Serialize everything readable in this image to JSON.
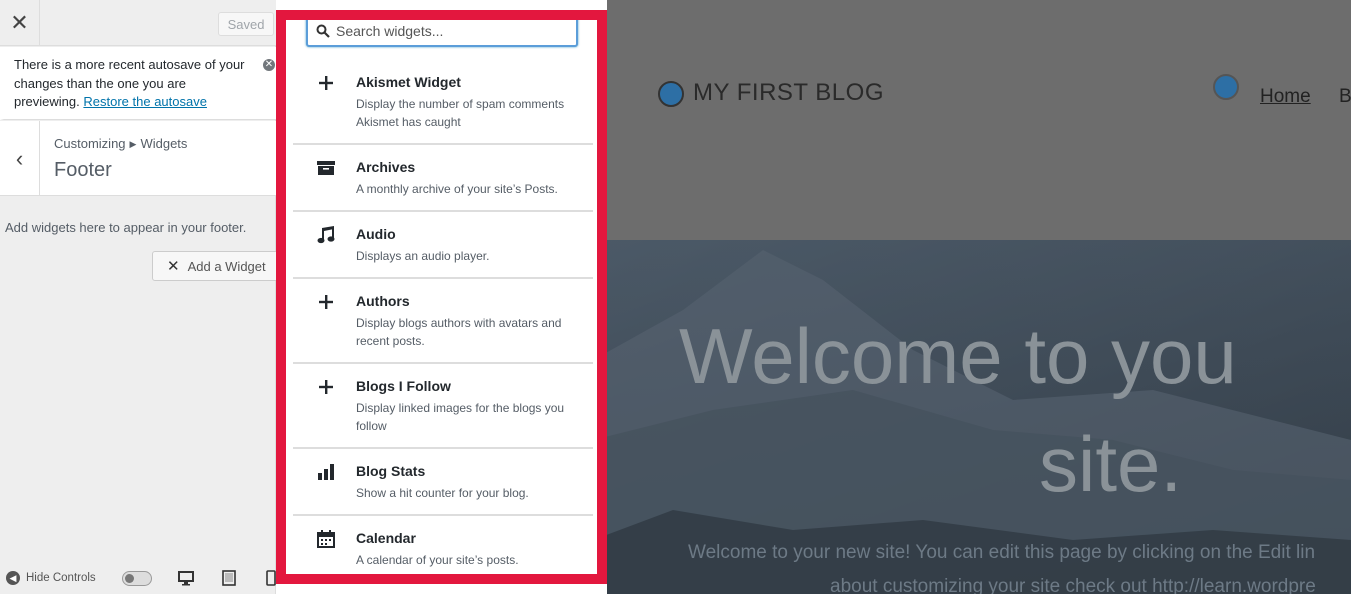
{
  "topbar": {
    "saved_label": "Saved"
  },
  "notice": {
    "text": "There is a more recent autosave of your changes than the one you are previewing.",
    "link": "Restore the autosave"
  },
  "section": {
    "breadcrumb_parent": "Customizing",
    "breadcrumb_child": "Widgets",
    "title": "Footer",
    "description": "Add widgets here to appear in your footer.",
    "add_widget_label": "Add a Widget"
  },
  "footer": {
    "hide_controls_label": "Hide Controls"
  },
  "search": {
    "placeholder": "Search widgets..."
  },
  "widgets": [
    {
      "title": "Akismet Widget",
      "description": "Display the number of spam comments Akismet has caught",
      "icon": "plus-icon"
    },
    {
      "title": "Archives",
      "description": "A monthly archive of your site’s Posts.",
      "icon": "archive-icon"
    },
    {
      "title": "Audio",
      "description": "Displays an audio player.",
      "icon": "music-note-icon"
    },
    {
      "title": "Authors",
      "description": "Display blogs authors with avatars and recent posts.",
      "icon": "plus-icon"
    },
    {
      "title": "Blogs I Follow",
      "description": "Display linked images for the blogs you follow",
      "icon": "plus-icon"
    },
    {
      "title": "Blog Stats",
      "description": "Show a hit counter for your blog.",
      "icon": "bar-chart-icon"
    },
    {
      "title": "Calendar",
      "description": "A calendar of your site’s posts.",
      "icon": "calendar-icon"
    }
  ],
  "preview": {
    "blog_title": "MY FIRST BLOG",
    "nav_home": "Home",
    "nav_next": "B",
    "hero_line1": "Welcome to you",
    "hero_line2": "site.",
    "hero_text_line1": "Welcome to your new site! You can edit this page by clicking on the Edit lin",
    "hero_text_line2": "about customizing your site check out http://learn.wordpre"
  },
  "colors": {
    "highlight_frame": "#e3173e",
    "link": "#0073aa",
    "focus": "#5b9dd9"
  }
}
